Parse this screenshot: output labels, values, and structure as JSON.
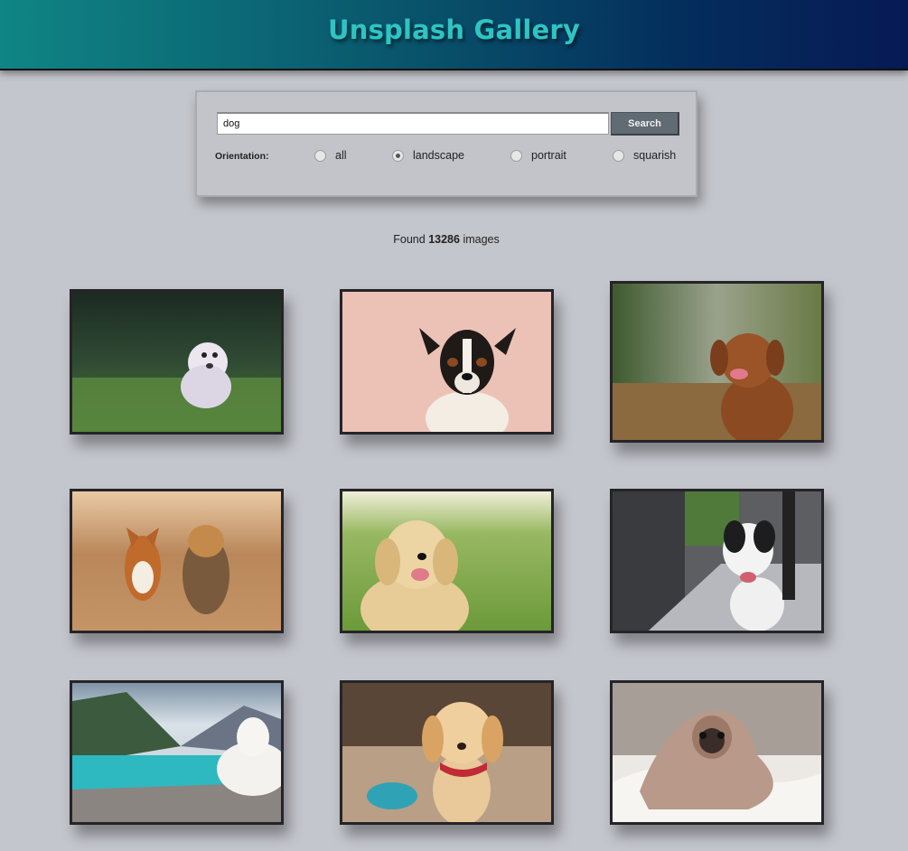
{
  "app": {
    "title": "Unsplash Gallery"
  },
  "search": {
    "value": "dog",
    "button_label": "Search"
  },
  "orientation": {
    "label": "Orientation:",
    "options": [
      "all",
      "landscape",
      "portrait",
      "squarish"
    ],
    "selected": "landscape"
  },
  "results": {
    "prefix": "Found",
    "count": "13286",
    "suffix": "images"
  },
  "gallery": [
    {
      "subject": "white fluffy dog running on grass"
    },
    {
      "subject": "jack russell terrier on pink background"
    },
    {
      "subject": "brown retriever on a forest path"
    },
    {
      "subject": "corgi and yorkie running on a dirt road"
    },
    {
      "subject": "golden retriever puppy on grass"
    },
    {
      "subject": "black and white dog on a sidewalk"
    },
    {
      "subject": "white dog by a turquoise mountain lake"
    },
    {
      "subject": "golden puppy with red collar"
    },
    {
      "subject": "pug wrapped in a blanket on a bed"
    }
  ],
  "colors": {
    "header_start": "#0f8585",
    "header_end": "#071a55",
    "title": "#2ec4c4",
    "background": "#c4c6cd",
    "button": "#616b73"
  }
}
